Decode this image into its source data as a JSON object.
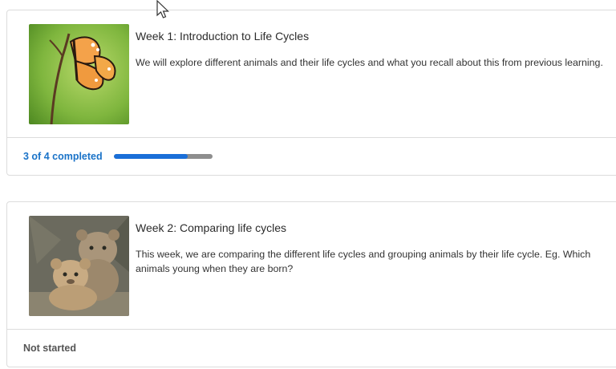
{
  "modules": [
    {
      "title": "Week 1: Introduction to Life Cycles",
      "description": "We will explore different animals and their life cycles and what you recall about this from previous learning.",
      "status_text": "3 of 4 completed",
      "progress": {
        "completed": 3,
        "total": 4,
        "fraction": 0.75
      },
      "image_icon": "butterfly-image",
      "colors": {
        "progress_fill": "#1a6fd8",
        "progress_track": "#8e8e8e",
        "status": "#1a73c8"
      }
    },
    {
      "title": "Week 2: Comparing life cycles",
      "description": "This week, we are comparing the different life cycles and grouping animals by their life cycle. Eg. Which animals young when they are born?",
      "status_text": "Not started",
      "image_icon": "lion-cubs-image"
    }
  ]
}
